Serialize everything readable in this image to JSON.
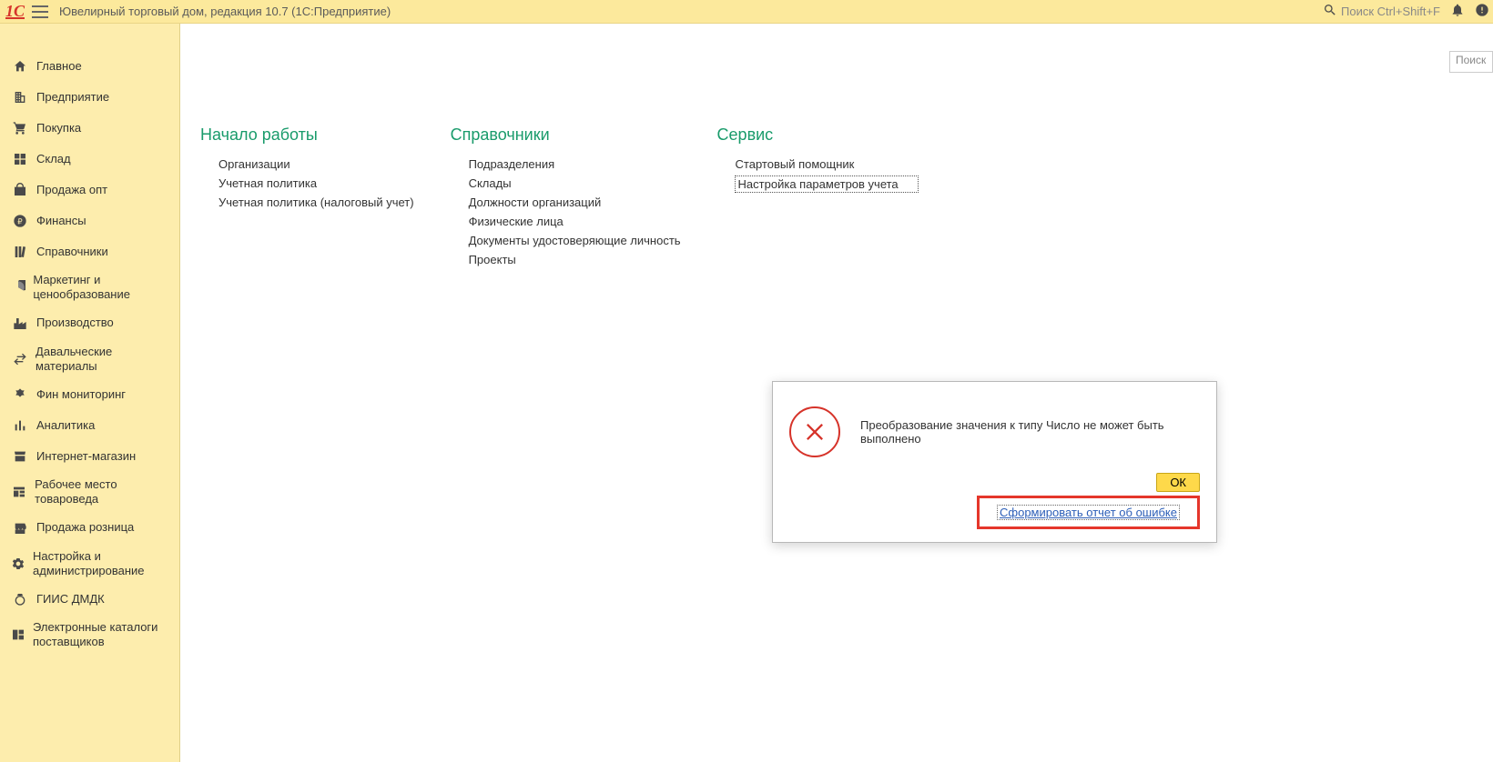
{
  "header": {
    "logo_text": "1С",
    "title": "Ювелирный торговый дом, редакция 10.7  (1С:Предприятие)",
    "search_placeholder": "Поиск Ctrl+Shift+F"
  },
  "local_search": {
    "placeholder": "Поиск"
  },
  "sidebar": [
    {
      "name": "home",
      "label": "Главное",
      "icon": "home"
    },
    {
      "name": "enterprise",
      "label": "Предприятие",
      "icon": "building"
    },
    {
      "name": "purchase",
      "label": "Покупка",
      "icon": "cart"
    },
    {
      "name": "warehouse",
      "label": "Склад",
      "icon": "boxes"
    },
    {
      "name": "sales-wholesale",
      "label": "Продажа опт",
      "icon": "bag"
    },
    {
      "name": "finance",
      "label": "Финансы",
      "icon": "ruble"
    },
    {
      "name": "references",
      "label": "Справочники",
      "icon": "books"
    },
    {
      "name": "marketing",
      "label": "Маркетинг и ценообразование",
      "icon": "pie"
    },
    {
      "name": "production",
      "label": "Производство",
      "icon": "factory"
    },
    {
      "name": "tolling",
      "label": "Давальческие материалы",
      "icon": "exchange"
    },
    {
      "name": "fin-monitoring",
      "label": "Фин мониторинг",
      "icon": "emblem"
    },
    {
      "name": "analytics",
      "label": "Аналитика",
      "icon": "chart"
    },
    {
      "name": "eshop",
      "label": "Интернет-магазин",
      "icon": "store"
    },
    {
      "name": "workplace",
      "label": "Рабочее место товароведа",
      "icon": "workplace"
    },
    {
      "name": "retail",
      "label": "Продажа розница",
      "icon": "shop"
    },
    {
      "name": "settings",
      "label": "Настройка и администрирование",
      "icon": "gear"
    },
    {
      "name": "giis",
      "label": "ГИИС ДМДК",
      "icon": "ring"
    },
    {
      "name": "catalogs",
      "label": "Электронные каталоги поставщиков",
      "icon": "catalog"
    }
  ],
  "columns": [
    {
      "name": "start",
      "title": "Начало работы",
      "items": [
        {
          "label": "Организации"
        },
        {
          "label": "Учетная политика"
        },
        {
          "label": "Учетная политика (налоговый учет)"
        }
      ]
    },
    {
      "name": "references",
      "title": "Справочники",
      "items": [
        {
          "label": "Подразделения"
        },
        {
          "label": "Склады"
        },
        {
          "label": "Должности организаций"
        },
        {
          "label": "Физические лица"
        },
        {
          "label": "Документы удостоверяющие личность"
        },
        {
          "label": "Проекты"
        }
      ]
    },
    {
      "name": "service",
      "title": "Сервис",
      "items": [
        {
          "label": "Стартовый помощник"
        },
        {
          "label": "Настройка параметров учета",
          "selected": true
        }
      ]
    }
  ],
  "dialog": {
    "message": "Преобразование значения к типу Число не может быть выполнено",
    "ok_label": "ОК",
    "report_link": "Сформировать отчет об ошибке"
  }
}
